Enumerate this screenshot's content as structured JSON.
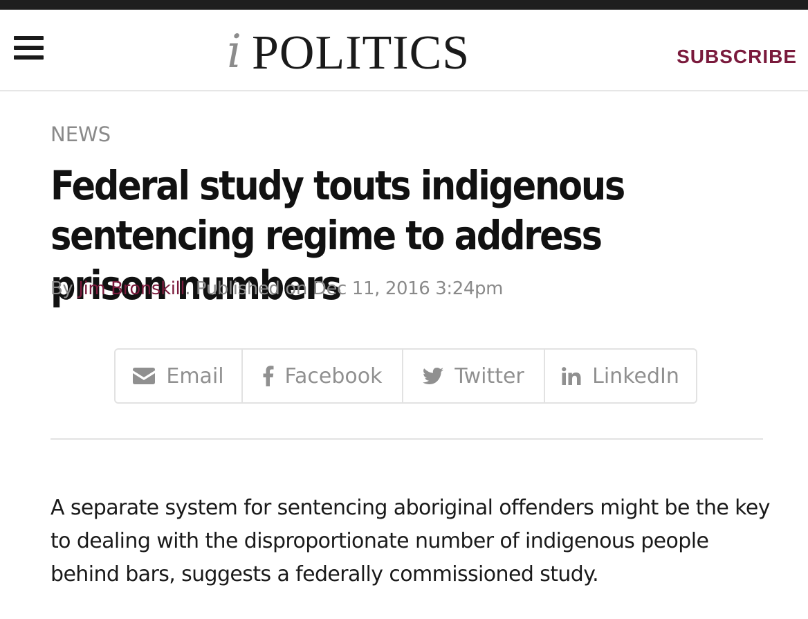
{
  "header": {
    "menu_icon": "hamburger-menu-icon",
    "logo": {
      "prefix": "i",
      "word": "POLITICS"
    },
    "subscribe_label": "SUBSCRIBE"
  },
  "article": {
    "section": "NEWS",
    "headline": "Federal study touts indigenous sentencing regime to address prison numbers",
    "byline": {
      "by": "By ",
      "author": "Jim Bronskill",
      "published": ". Published on Dec 11, 2016 3:24pm"
    },
    "share": [
      {
        "label": "Email",
        "icon": "envelope-icon"
      },
      {
        "label": "Facebook",
        "icon": "facebook-icon"
      },
      {
        "label": "Twitter",
        "icon": "twitter-icon"
      },
      {
        "label": "LinkedIn",
        "icon": "linkedin-icon"
      }
    ],
    "lead_paragraph": "A separate system for sentencing aboriginal offenders might be the key to dealing with the disproportionate number of indigenous people behind bars, suggests a federally commissioned study."
  },
  "colors": {
    "accent": "#7a1a3c",
    "muted_text": "#8a8a8a",
    "top_strip": "#1e1e1e",
    "border": "#e2e2e2"
  }
}
